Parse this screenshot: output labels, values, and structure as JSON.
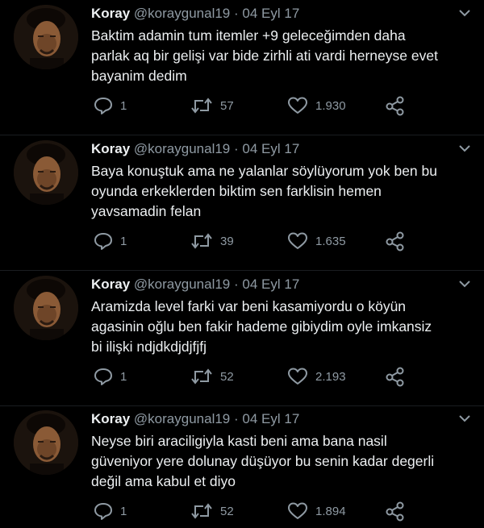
{
  "tweets": [
    {
      "name": "Koray",
      "handle": "@koraygunal19",
      "separator": "·",
      "date": "04 Eyl 17",
      "lines": [
        "Baktim adamin tum itemler +9 geleceğimden daha",
        "parlak aq bir gelişi var bide zirhli ati vardi herneyse evet",
        "bayanim dedim"
      ],
      "replies": "1",
      "retweets": "57",
      "likes": "1.930"
    },
    {
      "name": "Koray",
      "handle": "@koraygunal19",
      "separator": "·",
      "date": "04 Eyl 17",
      "lines": [
        "Baya konuştuk ama ne yalanlar söylüyorum yok ben bu",
        "oyunda erkeklerden biktim sen farklisin hemen",
        "yavsamadin felan"
      ],
      "replies": "1",
      "retweets": "39",
      "likes": "1.635"
    },
    {
      "name": "Koray",
      "handle": "@koraygunal19",
      "separator": "·",
      "date": "04 Eyl 17",
      "lines": [
        "Aramizda level farki var beni kasamiyordu o köyün",
        "agasinin oğlu ben fakir hademe gibiydim oyle imkansiz",
        "bi ilişki ndjdkdjdjfjfj"
      ],
      "replies": "1",
      "retweets": "52",
      "likes": "2.193"
    },
    {
      "name": "Koray",
      "handle": "@koraygunal19",
      "separator": "·",
      "date": "04 Eyl 17",
      "lines": [
        "Neyse biri araciligiyla kasti beni ama bana nasil",
        "güveniyor yere dolunay düşüyor bu senin kadar degerli",
        "değil ama kabul et diyo"
      ],
      "replies": "1",
      "retweets": "52",
      "likes": "1.894"
    }
  ],
  "icons": {
    "avatar": "profile-photo",
    "caret": "chevron-down-icon",
    "reply": "reply-icon",
    "retweet": "retweet-icon",
    "like": "heart-icon",
    "share": "share-icon"
  },
  "colors": {
    "background": "#000000",
    "text": "#eceff1",
    "muted": "#8f9aa3"
  }
}
